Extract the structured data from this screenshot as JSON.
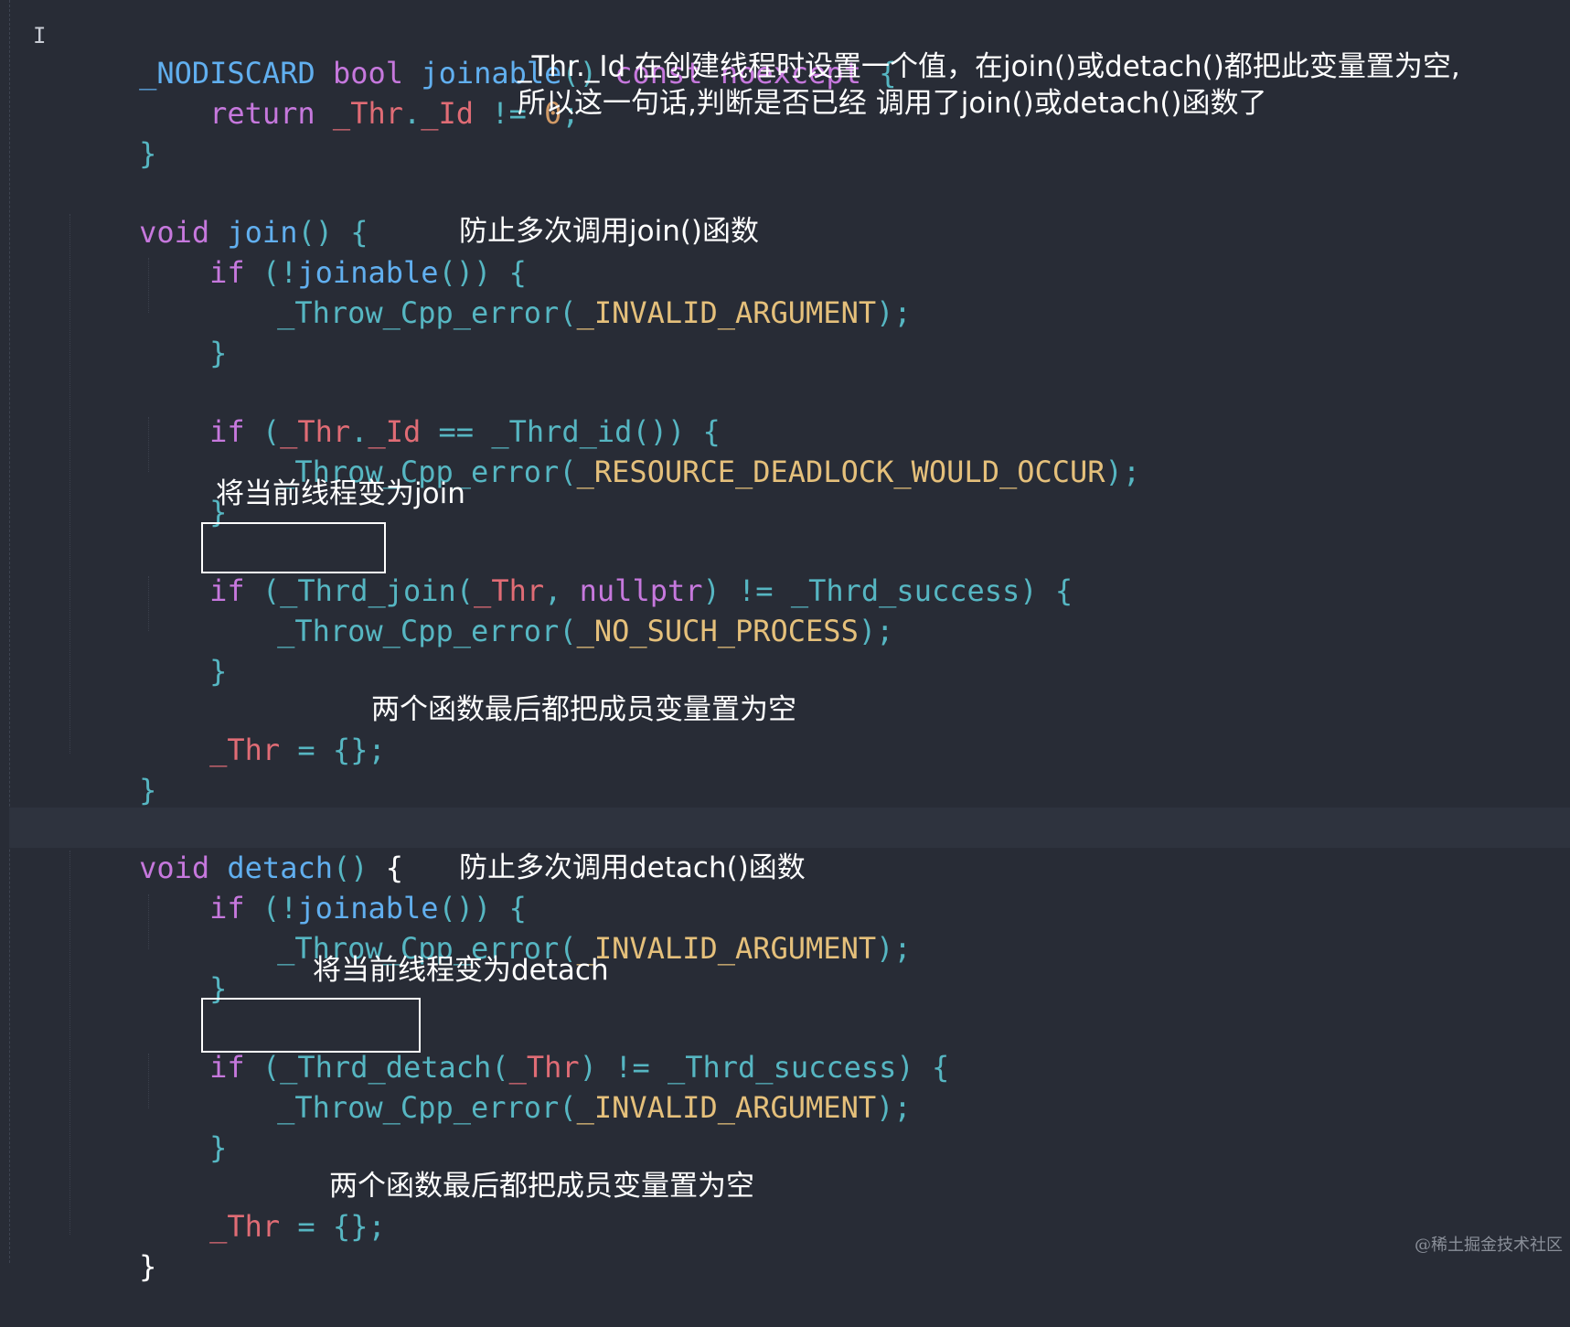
{
  "code": {
    "l1": {
      "t1": "_NODISCARD",
      "t2": "bool",
      "t3": "joinable",
      "t4": "()",
      "t5": "const",
      "t6": "noexcept",
      "t7": "{"
    },
    "l2": {
      "t1": "return",
      "t2": "_Thr",
      "t3": ".",
      "t4": "_Id",
      "t5": "!=",
      "t6": "0",
      "t7": ";"
    },
    "l3": {
      "t1": "}"
    },
    "l4": {
      "t1": "void",
      "t2": "join",
      "t3": "()",
      "t4": "{"
    },
    "l5": {
      "t1": "if",
      "t2": "(!",
      "t3": "joinable",
      "t4": "())",
      "t5": "{"
    },
    "l6": {
      "t1": "_Throw_Cpp_error",
      "t2": "(",
      "t3": "_INVALID_ARGUMENT",
      "t4": ");"
    },
    "l7": {
      "t1": "}"
    },
    "l8": {
      "t1": "if",
      "t2": "(",
      "t3": "_Thr",
      "t4": ".",
      "t5": "_Id",
      "t6": "==",
      "t7": "_Thrd_id",
      "t8": "())",
      "t9": "{"
    },
    "l9": {
      "t1": "_Throw_Cpp_error",
      "t2": "(",
      "t3": "_RESOURCE_DEADLOCK_WOULD_OCCUR",
      "t4": ");"
    },
    "l10": {
      "t1": "}"
    },
    "l11": {
      "t1": "if",
      "t2": "(",
      "t3": "_Thrd_join",
      "t4": "(",
      "t5": "_Thr",
      "t6": ",",
      "t7": "nullptr",
      "t8": ")",
      "t9": "!=",
      "t10": "_Thrd_success",
      "t11": ")",
      "t12": "{"
    },
    "l12": {
      "t1": "_Throw_Cpp_error",
      "t2": "(",
      "t3": "_NO_SUCH_PROCESS",
      "t4": ");"
    },
    "l13": {
      "t1": "}"
    },
    "l14": {
      "t1": "_Thr",
      "t2": "=",
      "t3": "{};"
    },
    "l15": {
      "t1": "}"
    },
    "l16": {
      "t1": "void",
      "t2": "detach",
      "t3": "()",
      "t4": "{"
    },
    "l17": {
      "t1": "if",
      "t2": "(!",
      "t3": "joinable",
      "t4": "())",
      "t5": "{"
    },
    "l18": {
      "t1": "_Throw_Cpp_error",
      "t2": "(",
      "t3": "_INVALID_ARGUMENT",
      "t4": ");"
    },
    "l19": {
      "t1": "}"
    },
    "l20": {
      "t1": "if",
      "t2": "(",
      "t3": "_Thrd_detach",
      "t4": "(",
      "t5": "_Thr",
      "t6": ")",
      "t7": "!=",
      "t8": "_Thrd_success",
      "t9": ")",
      "t10": "{"
    },
    "l21": {
      "t1": "_Throw_Cpp_error",
      "t2": "(",
      "t3": "_INVALID_ARGUMENT",
      "t4": ");"
    },
    "l22": {
      "t1": "}"
    },
    "l23": {
      "t1": "_Thr",
      "t2": "=",
      "t3": "{};"
    },
    "l24": {
      "t1": "}"
    }
  },
  "annotations": {
    "id_note_1": "_Thr._Id 在创建线程时设置一个值，在join()或detach()都把此变量置为空,",
    "id_note_2": "所以这一句话,判断是否已经 调用了join()或detach()函数了",
    "join_guard": "防止多次调用join()函数",
    "join_state": "将当前线程变为join",
    "join_reset": "两个函数最后都把成员变量置为空",
    "detach_guard": "防止多次调用detach()函数",
    "detach_state": "将当前线程变为detach",
    "detach_reset": "两个函数最后都把成员变量置为空"
  },
  "watermark": "@稀土掘金技术社区",
  "colors": {
    "background": "#282c36",
    "keyword": "#c678dd",
    "function": "#61afef",
    "class_member": "#56b6c2",
    "variable": "#e06c75",
    "number": "#d19a66",
    "annotation_text": "#ffffff"
  },
  "icons": {
    "cursor": "text-cursor-icon"
  }
}
